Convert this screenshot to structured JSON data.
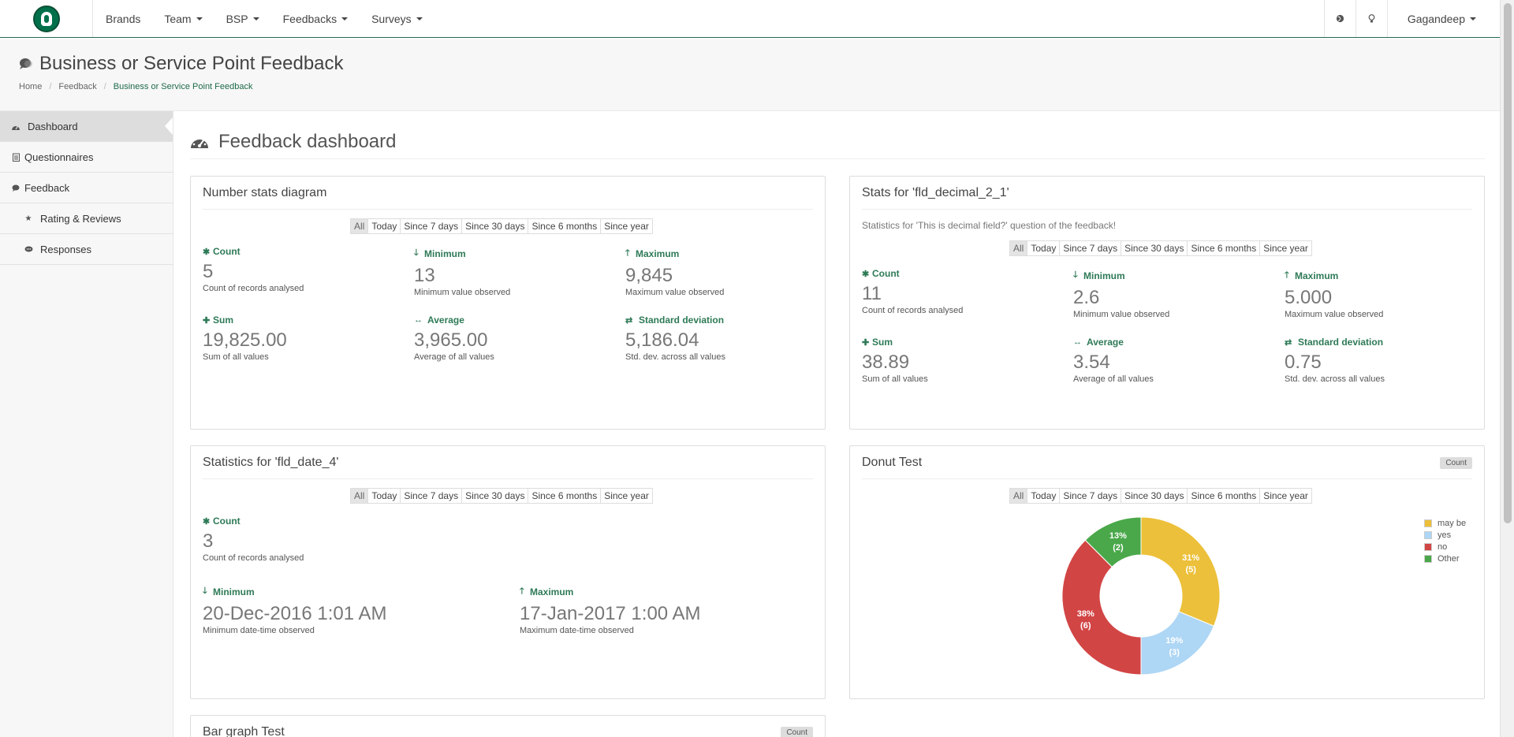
{
  "nav": {
    "items": [
      "Brands",
      "Team",
      "BSP",
      "Feedbacks",
      "Surveys"
    ],
    "user": "Gagandeep"
  },
  "header": {
    "title": "Business or Service Point Feedback",
    "breadcrumb": [
      "Home",
      "Feedback",
      "Business or Service Point Feedback"
    ]
  },
  "sidebar": {
    "items": [
      {
        "label": "Dashboard",
        "icon": "dashboard-icon"
      },
      {
        "label": "Questionnaires",
        "icon": "clipboard-icon"
      },
      {
        "label": "Feedback",
        "icon": "comment-icon"
      },
      {
        "label": "Rating & Reviews",
        "icon": "star-icon"
      },
      {
        "label": "Responses",
        "icon": "chat-icon"
      }
    ]
  },
  "main": {
    "title": "Feedback dashboard"
  },
  "filters": [
    "All",
    "Today",
    "Since 7 days",
    "Since 30 days",
    "Since 6 months",
    "Since year"
  ],
  "panels": {
    "number_stats": {
      "title": "Number stats diagram",
      "stats": [
        {
          "label": "Count",
          "value": "5",
          "desc": "Count of records analysed"
        },
        {
          "label": "Minimum",
          "value": "13",
          "desc": "Minimum value observed"
        },
        {
          "label": "Maximum",
          "value": "9,845",
          "desc": "Maximum value observed"
        },
        {
          "label": "Sum",
          "value": "19,825.00",
          "desc": "Sum of all values"
        },
        {
          "label": "Average",
          "value": "3,965.00",
          "desc": "Average of all values"
        },
        {
          "label": "Standard deviation",
          "value": "5,186.04",
          "desc": "Std. dev. across all values"
        }
      ]
    },
    "decimal_stats": {
      "title": "Stats for 'fld_decimal_2_1'",
      "subtitle": "Statistics for 'This is decimal field?' question of the feedback!",
      "stats": [
        {
          "label": "Count",
          "value": "11",
          "desc": "Count of records analysed"
        },
        {
          "label": "Minimum",
          "value": "2.6",
          "desc": "Minimum value observed"
        },
        {
          "label": "Maximum",
          "value": "5.000",
          "desc": "Maximum value observed"
        },
        {
          "label": "Sum",
          "value": "38.89",
          "desc": "Sum of all values"
        },
        {
          "label": "Average",
          "value": "3.54",
          "desc": "Average of all values"
        },
        {
          "label": "Standard deviation",
          "value": "0.75",
          "desc": "Std. dev. across all values"
        }
      ]
    },
    "date_stats": {
      "title": "Statistics for 'fld_date_4'",
      "stats": [
        {
          "label": "Count",
          "value": "3",
          "desc": "Count of records analysed"
        },
        {
          "label": "Minimum",
          "value": "20-Dec-2016 1:01 AM",
          "desc": "Minimum date-time observed"
        },
        {
          "label": "Maximum",
          "value": "17-Jan-2017 1:00 AM",
          "desc": "Maximum date-time observed"
        }
      ]
    },
    "donut": {
      "title": "Donut Test",
      "badge": "Count"
    },
    "bar": {
      "title": "Bar graph Test",
      "badge": "Count"
    }
  },
  "chart_data": {
    "type": "pie",
    "title": "Donut Test",
    "categories": [
      "may be",
      "yes",
      "no",
      "Other"
    ],
    "values": [
      5,
      3,
      6,
      2
    ],
    "percent_labels": [
      "31%",
      "19%",
      "38%",
      "13%"
    ],
    "count_labels": [
      "(5)",
      "(3)",
      "(6)",
      "(2)"
    ],
    "colors": [
      "#ecc03a",
      "#aed6f5",
      "#d24545",
      "#4aa84a"
    ],
    "legend_position": "right"
  }
}
